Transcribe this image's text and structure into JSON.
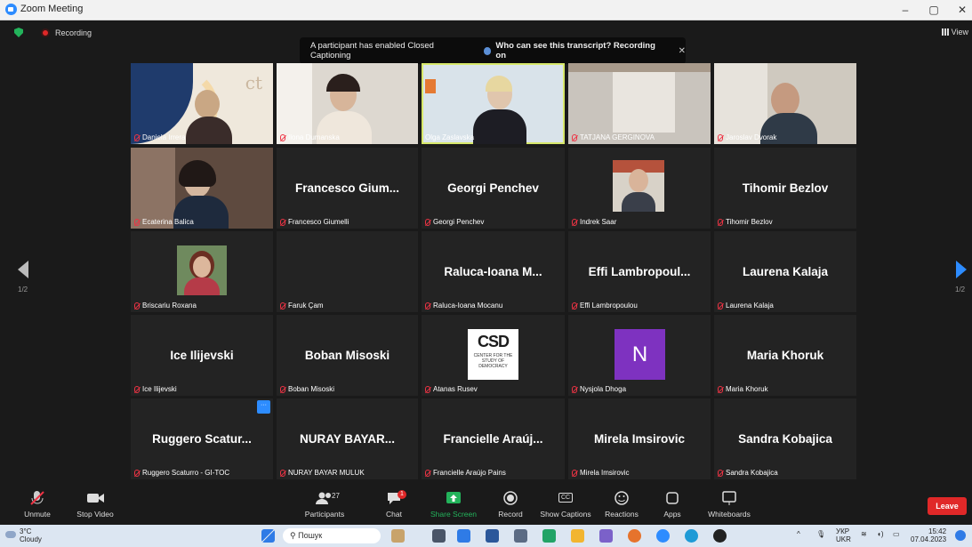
{
  "window": {
    "title": "Zoom Meeting",
    "controls": [
      "–",
      "▢",
      "✕"
    ]
  },
  "status": {
    "recording_label": "Recording",
    "view_label": "View"
  },
  "banner": {
    "message": "A participant has enabled Closed Captioning",
    "question": "Who can see this transcript? Recording on",
    "close": "✕"
  },
  "pager": {
    "left": "1/2",
    "right": "1/2"
  },
  "participants": [
    {
      "caption": "Daniela Irrera",
      "display": ""
    },
    {
      "caption": "Ilona Dumanska",
      "display": ""
    },
    {
      "caption": "Olga Zaslavska",
      "display": ""
    },
    {
      "caption": "TATJANA GERGINOVA",
      "display": ""
    },
    {
      "caption": "Jaroslav Dvorak",
      "display": ""
    },
    {
      "caption": "Ecaterina Balica",
      "display": ""
    },
    {
      "caption": "Francesco Giumelli",
      "display": "Francesco Gium..."
    },
    {
      "caption": "Georgi Penchev",
      "display": "Georgi Penchev"
    },
    {
      "caption": "Indrek Saar",
      "display": ""
    },
    {
      "caption": "Tihomir Bezlov",
      "display": "Tihomir Bezlov"
    },
    {
      "caption": "Briscariu Roxana",
      "display": ""
    },
    {
      "caption": "Faruk Çam",
      "display": ""
    },
    {
      "caption": "Raluca-Ioana Mocanu",
      "display": "Raluca-Ioana M..."
    },
    {
      "caption": "Effi Lambropoulou",
      "display": "Effi Lambropoul..."
    },
    {
      "caption": "Laurena Kalaja",
      "display": "Laurena Kalaja"
    },
    {
      "caption": "Ice Ilijevski",
      "display": "Ice Ilijevski"
    },
    {
      "caption": "Boban Misoski",
      "display": "Boban Misoski"
    },
    {
      "caption": "Atanas Rusev",
      "display": ""
    },
    {
      "caption": "Nysjola Dhoga",
      "display": ""
    },
    {
      "caption": "Maria Khoruk",
      "display": "Maria Khoruk"
    },
    {
      "caption": "Ruggero Scaturro - GI-TOC",
      "display": "Ruggero Scatur..."
    },
    {
      "caption": "NURAY BAYAR MULUK",
      "display": "NURAY BAYAR..."
    },
    {
      "caption": "Francielle Araújo Pains",
      "display": "Francielle Araúj..."
    },
    {
      "caption": "Mirela Imsirovic",
      "display": "Mirela Imsirovic"
    },
    {
      "caption": "Sandra Kobajica",
      "display": "Sandra Kobajica"
    }
  ],
  "tile_texts": {
    "ct_logo": "ct",
    "csd_big": "CSD",
    "csd_small": "CENTER FOR THE STUDY OF DEMOCRACY",
    "n_letter": "N",
    "badge": "···"
  },
  "toolbar": {
    "unmute": "Unmute",
    "stop_video": "Stop Video",
    "participants": "Participants",
    "participants_count": "27",
    "chat": "Chat",
    "chat_badge": "1",
    "share_screen": "Share Screen",
    "record": "Record",
    "show_captions": "Show Captions",
    "captions_icon": "CC",
    "reactions": "Reactions",
    "apps": "Apps",
    "whiteboards": "Whiteboards",
    "leave": "Leave"
  },
  "taskbar": {
    "weather_temp": "3°C",
    "weather_desc": "Cloudy",
    "search": "Пошук",
    "lang_top": "УКР",
    "lang_bottom": "UKR",
    "time": "15:42",
    "date": "07.04.2023"
  },
  "colors": {
    "active_border": "#d7e86b",
    "leave": "#e02828",
    "share_green": "#23b35b",
    "accent_blue": "#2d8cff"
  }
}
